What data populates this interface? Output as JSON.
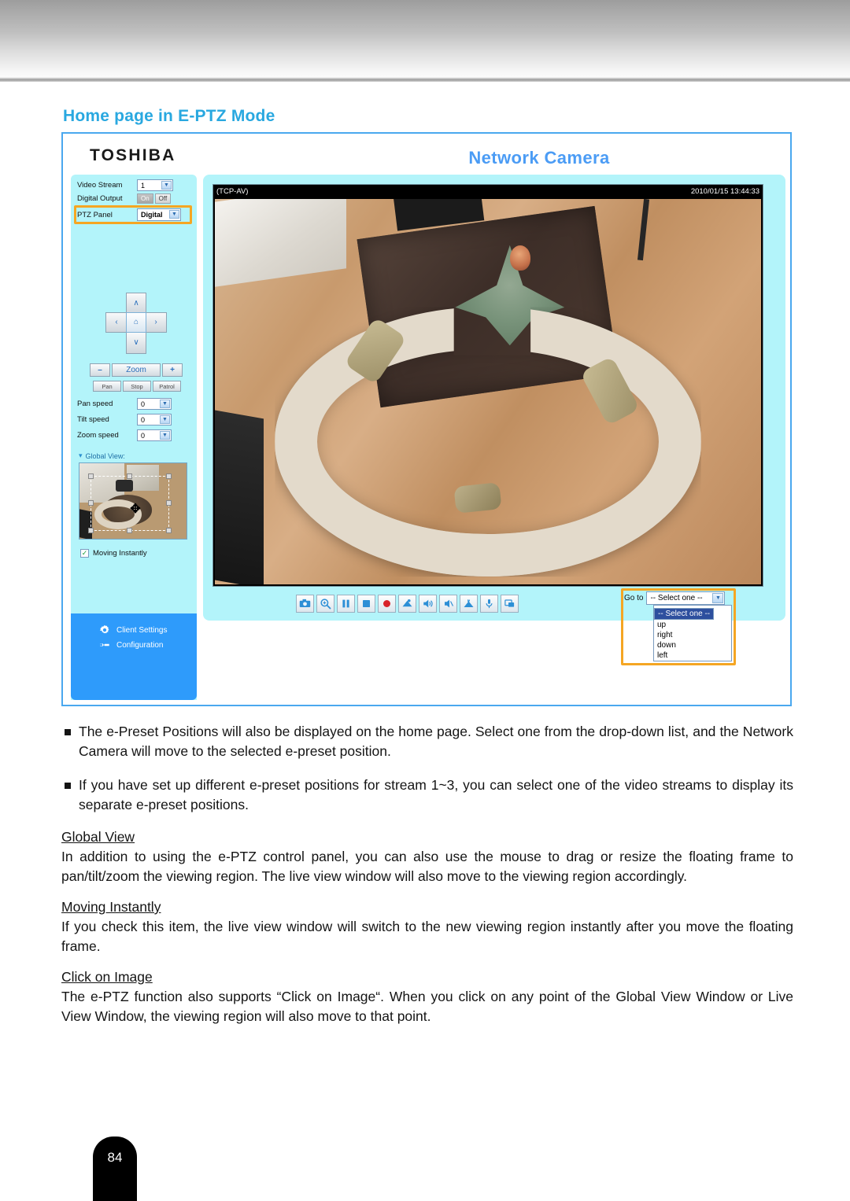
{
  "page": {
    "heading": "Home page in E-PTZ Mode",
    "number": "84"
  },
  "camera_ui": {
    "logo": "TOSHIBA",
    "brand_title": "Network Camera",
    "controls": {
      "video_stream_label": "Video Stream",
      "video_stream_value": "1",
      "digital_output_label": "Digital Output",
      "digital_output_on": "On",
      "digital_output_off": "Off",
      "ptz_panel_label": "PTZ Panel",
      "ptz_panel_value": "Digital"
    },
    "dpad": {
      "up": "∧",
      "down": "∨",
      "left": "‹",
      "right": "›",
      "home": "⌂"
    },
    "zoom": {
      "minus": "–",
      "label": "Zoom",
      "plus": "+"
    },
    "patrol_buttons": [
      "Pan",
      "Stop",
      "Patrol"
    ],
    "speeds": [
      {
        "label": "Pan speed",
        "value": "0"
      },
      {
        "label": "Tilt speed",
        "value": "0"
      },
      {
        "label": "Zoom speed",
        "value": "0"
      }
    ],
    "global_view": {
      "label": "Global View:",
      "moving_instantly_label": "Moving Instantly",
      "moving_instantly_checked": "✓"
    },
    "nav": [
      {
        "label": "Client Settings",
        "icon": "gear-icon"
      },
      {
        "label": "Configuration",
        "icon": "wrench-icon"
      }
    ],
    "video": {
      "protocol": "(TCP-AV)",
      "timestamp": "2010/01/15 13:44:33"
    },
    "toolbar": [
      "snapshot-icon",
      "digital-zoom-icon",
      "pause-icon",
      "stop-icon",
      "record-icon",
      "video-clip-icon",
      "volume-icon",
      "mute-icon",
      "talk-icon",
      "mic-icon",
      "fullscreen-icon"
    ],
    "goto": {
      "label": "Go to",
      "value": "-- Select one --",
      "options": [
        "-- Select one --",
        "up",
        "right",
        "down",
        "left"
      ],
      "selected_index": 0
    }
  },
  "content": {
    "bullet1": "The e-Preset Positions will also be displayed on the home page. Select one from the drop-down list, and the Network Camera will move to the selected e-preset position.",
    "bullet2": "If you have set up different e-preset positions for stream 1~3, you can select one of the video streams to display its separate e-preset positions.",
    "sections": [
      {
        "heading": "Global View",
        "paragraph": "In addition to using the e-PTZ control panel, you can also use the mouse to drag or resize the floating frame to pan/tilt/zoom the viewing region. The live view window will also move to the viewing region accordingly."
      },
      {
        "heading": "Moving Instantly",
        "paragraph": "If you check this item, the live view window will switch to the new viewing region instantly after you move the floating frame."
      },
      {
        "heading": "Click on Image",
        "paragraph": "The e-PTZ function also supports “Click on Image“. When you click on any point of the Global View Window or Live View Window, the viewing region will also move to that point."
      }
    ]
  },
  "colors": {
    "heading_blue": "#29a8e0",
    "brand_blue": "#4b9cf5",
    "panel_cyan": "#b3f4fa",
    "nav_blue": "#2e9bfb",
    "highlight_orange": "#f5a623"
  }
}
